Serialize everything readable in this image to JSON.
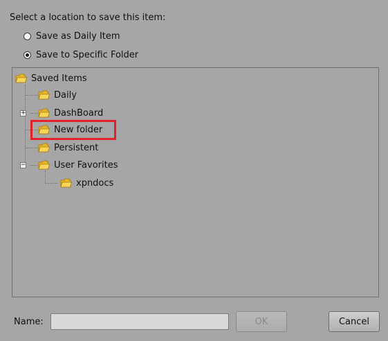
{
  "prompt": "Select a location to save this item:",
  "options": [
    {
      "label": "Save as Daily Item",
      "selected": false
    },
    {
      "label": "Save to Specific Folder",
      "selected": true
    }
  ],
  "tree": {
    "root": "Saved Items",
    "items": [
      {
        "label": "Daily"
      },
      {
        "label": "DashBoard",
        "expander": "+"
      },
      {
        "label": "New folder",
        "highlighted": true
      },
      {
        "label": "Persistent"
      },
      {
        "label": "User Favorites",
        "expander": "−"
      },
      {
        "label": "xpndocs"
      }
    ]
  },
  "footer": {
    "name_label": "Name:",
    "name_value": "",
    "ok_label": "OK",
    "cancel_label": "Cancel"
  },
  "colors": {
    "background": "#a6a6a6",
    "highlight": "#e4202a",
    "folder": "#f2c43d"
  }
}
